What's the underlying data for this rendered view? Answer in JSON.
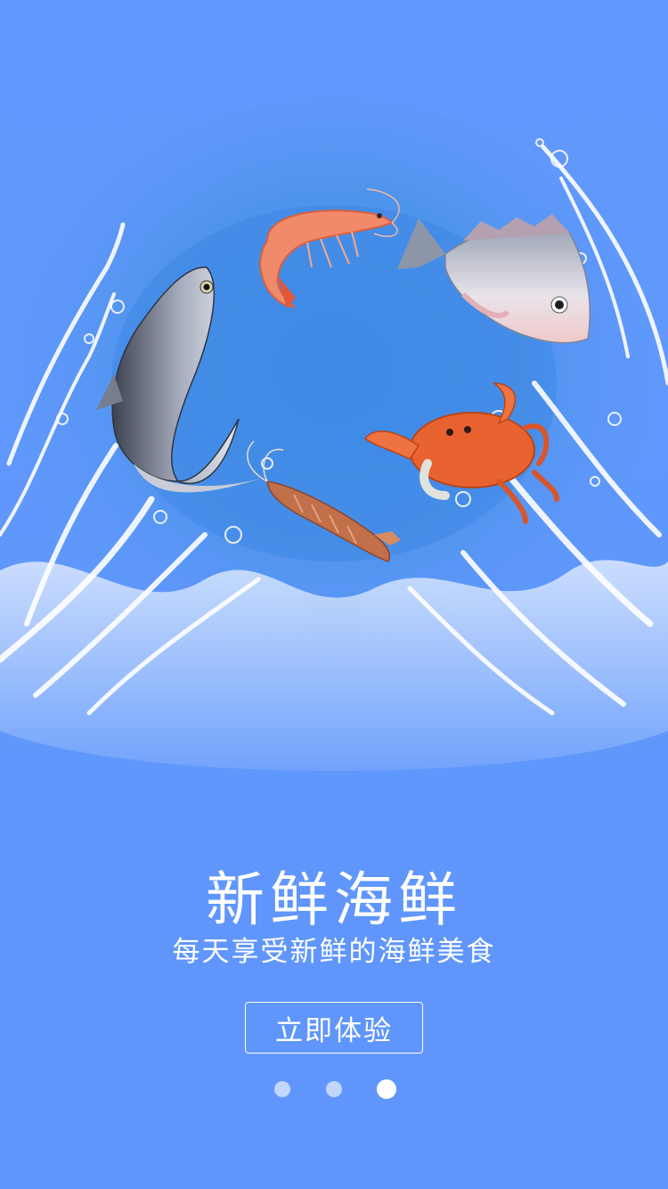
{
  "splash": {
    "title": "新鲜海鲜",
    "subtitle": "每天享受新鲜的海鲜美食",
    "cta_label": "立即体验",
    "page_indicator": {
      "total": 3,
      "active": 3
    }
  },
  "illustration": {
    "items": [
      "shrimp",
      "sea-bream-fish",
      "milkfish",
      "crab",
      "mantis-shrimp",
      "water-splash"
    ]
  },
  "colors": {
    "background": "#6196fd",
    "text": "#ffffff",
    "dot_inactive": "rgba(255,255,255,0.62)",
    "dot_active": "#ffffff"
  }
}
